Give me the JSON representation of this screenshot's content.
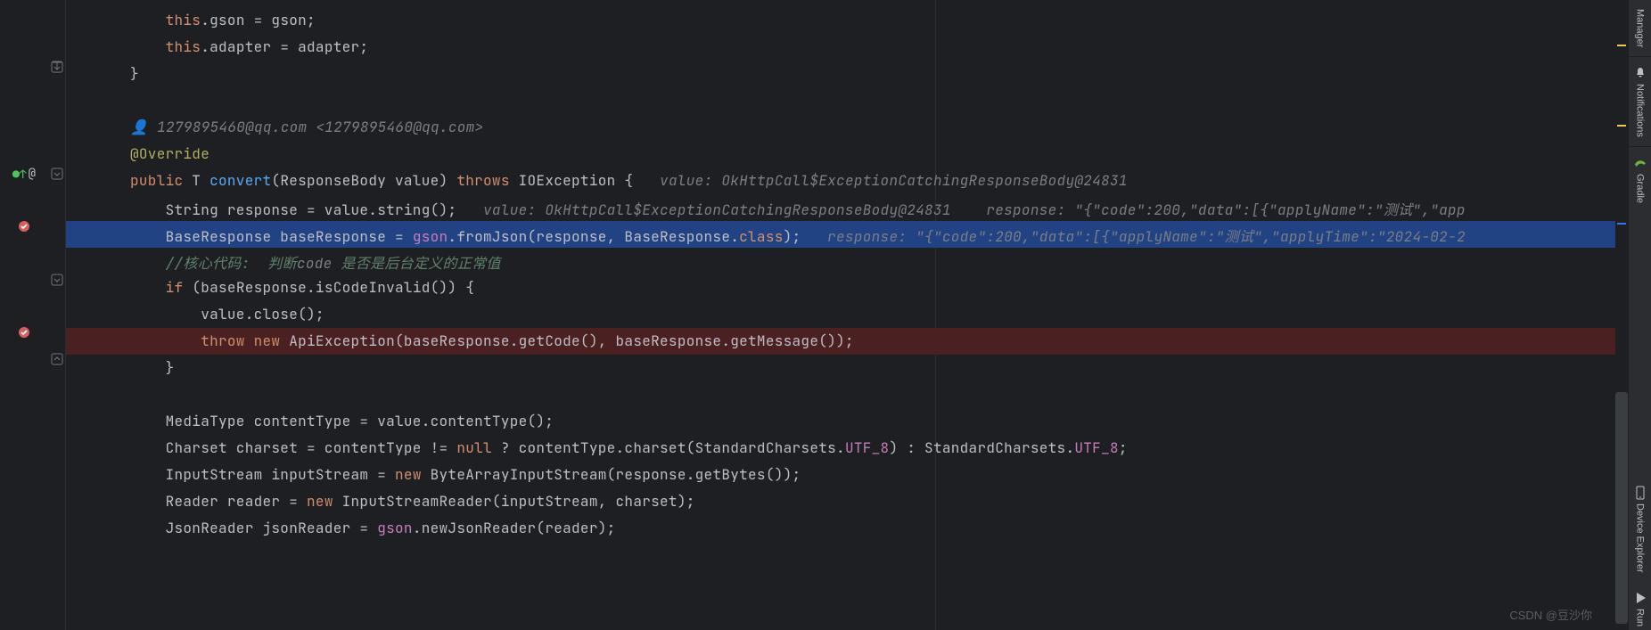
{
  "gutter": {
    "at_symbol": "@",
    "bp_active_color": "#db5c5c",
    "bp_check_color": "#ffffff",
    "green_up": "↑"
  },
  "right_bar": {
    "tools": [
      {
        "label": "Manager",
        "icon": "manager"
      },
      {
        "label": "Notifications",
        "icon": "bell"
      },
      {
        "label": "Gradle",
        "icon": "gradle"
      },
      {
        "label": "Device Explorer",
        "icon": "device"
      },
      {
        "label": "Run",
        "icon": "run"
      }
    ]
  },
  "watermark": "CSDN @豆沙你",
  "author": "1279895460@qq.com <1279895460@qq.com>",
  "code": {
    "l1_a": "this",
    "l1_b": ".gson = gson;",
    "l2_a": "this",
    "l2_b": ".adapter = adapter;",
    "l3": "}",
    "l5_icon": "👤 ",
    "l6": "@Override",
    "l7_a": "public",
    "l7_b": " T ",
    "l7_c": "convert",
    "l7_d": "(ResponseBody value) ",
    "l7_e": "throws",
    "l7_f": " IOException {   ",
    "l7_g": "value: OkHttpCall$ExceptionCatchingResponseBody@24831",
    "l8_a": "String response = value.string();   ",
    "l8_b": "value: OkHttpCall$ExceptionCatchingResponseBody@24831    response: \"{\"code\":200,\"data\":[{\"applyName\":\"测试\",\"app",
    "l9_a": "BaseResponse baseResponse = ",
    "l9_b": "gson",
    "l9_c": ".fromJson(response, BaseResponse.",
    "l9_d": "class",
    "l9_e": ");   ",
    "l9_f": "response: \"{\"code\":200,\"data\":[{\"applyName\":\"测试\",\"applyTime\":\"2024-02-2",
    "l10_a": "//核心代码:  判断",
    "l10_b": "code",
    "l10_c": " 是否是后台定义的正常值",
    "l11_a": "if",
    "l11_b": " (baseResponse.isCodeInvalid()) {",
    "l12": "value.close();",
    "l13_a": "throw new",
    "l13_b": " ApiException(baseResponse.getCode(), baseResponse.getMessage());",
    "l14": "}",
    "l16": "MediaType contentType = value.contentType();",
    "l17_a": "Charset charset = contentType != ",
    "l17_b": "null",
    "l17_c": " ? contentType.charset(StandardCharsets.",
    "l17_d": "UTF_8",
    "l17_e": ") : StandardCharsets.",
    "l17_f": "UTF_8",
    "l17_g": ";",
    "l18_a": "InputStream inputStream = ",
    "l18_b": "new",
    "l18_c": " ByteArrayInputStream(response.getBytes());",
    "l19_a": "Reader reader = ",
    "l19_b": "new",
    "l19_c": " InputStreamReader(inputStream, charset);",
    "l20_a": "JsonReader jsonReader = ",
    "l20_b": "gson",
    "l20_c": ".newJsonReader(reader);"
  }
}
